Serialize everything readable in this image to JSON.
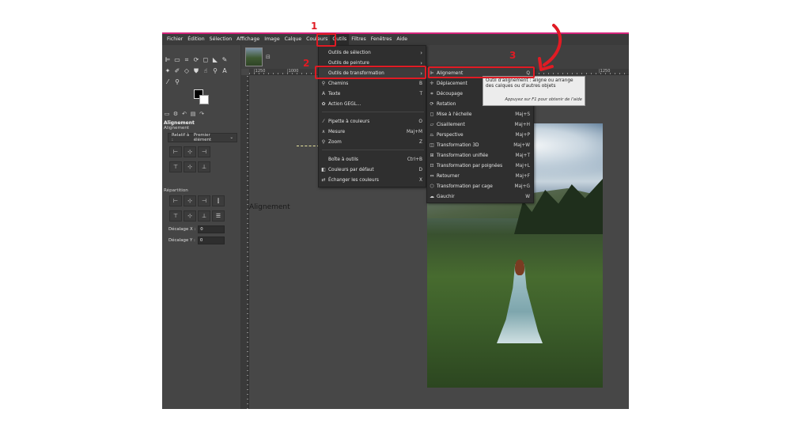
{
  "menubar": {
    "items": [
      "Fichier",
      "Édition",
      "Sélection",
      "Affichage",
      "Image",
      "Calque",
      "Couleurs",
      "Outils",
      "Filtres",
      "Fenêtres",
      "Aide"
    ],
    "active_index": 7
  },
  "ruler": {
    "labels": [
      "|1250",
      "|1000",
      "|1250"
    ]
  },
  "tool_options": {
    "title": "Alignement",
    "subtitle": "Alignement",
    "relatif_label": "Relatif à :",
    "relatif_value": "Premier élément",
    "repartition_label": "Répartition",
    "offset_x_label": "Décalage X :",
    "offset_x_value": "0",
    "offset_y_label": "Décalage Y :",
    "offset_y_value": "0"
  },
  "outils_menu": {
    "items": [
      {
        "label": "Outils de sélection",
        "shortcut": "",
        "has_submenu": true
      },
      {
        "label": "Outils de peinture",
        "shortcut": "",
        "has_submenu": true
      },
      {
        "label": "Outils de transformation",
        "shortcut": "",
        "has_submenu": true
      },
      {
        "label": "Chemins",
        "shortcut": "B",
        "has_submenu": false
      },
      {
        "label": "Texte",
        "shortcut": "T",
        "has_submenu": false
      },
      {
        "label": "Action GEGL...",
        "shortcut": "",
        "has_submenu": false
      },
      {
        "label": "Pipette à couleurs",
        "shortcut": "O",
        "has_submenu": false
      },
      {
        "label": "Mesure",
        "shortcut": "Maj+M",
        "has_submenu": false
      },
      {
        "label": "Zoom",
        "shortcut": "Z",
        "has_submenu": false
      },
      {
        "label": "Boîte à outils",
        "shortcut": "Ctrl+B",
        "has_submenu": false
      },
      {
        "label": "Couleurs par défaut",
        "shortcut": "D",
        "has_submenu": false
      },
      {
        "label": "Échanger les couleurs",
        "shortcut": "X",
        "has_submenu": false
      }
    ]
  },
  "transform_menu": {
    "items": [
      {
        "label": "Alignement",
        "shortcut": "Q"
      },
      {
        "label": "Déplacement",
        "shortcut": ""
      },
      {
        "label": "Découpage",
        "shortcut": ""
      },
      {
        "label": "Rotation",
        "shortcut": ""
      },
      {
        "label": "Mise à l'échelle",
        "shortcut": "Maj+S"
      },
      {
        "label": "Cisaillement",
        "shortcut": "Maj+H"
      },
      {
        "label": "Perspective",
        "shortcut": "Maj+P"
      },
      {
        "label": "Transformation 3D",
        "shortcut": "Maj+W"
      },
      {
        "label": "Transformation unifiée",
        "shortcut": "Maj+T"
      },
      {
        "label": "Transformation par poignées",
        "shortcut": "Maj+L"
      },
      {
        "label": "Retourner",
        "shortcut": "Maj+F"
      },
      {
        "label": "Transformation par cage",
        "shortcut": "Maj+G"
      },
      {
        "label": "Gauchir",
        "shortcut": "W"
      }
    ]
  },
  "tooltip": {
    "text": "Outil d'alignement : aligne ou arrange des calques ou d'autres objets",
    "hint": "Appuyez sur F1 pour obtenir de l'aide"
  },
  "canvas": {
    "overlay_label": "Alignement"
  },
  "annotations": {
    "step1": "1",
    "step2": "2",
    "step3": "3",
    "color": "#e01b24"
  }
}
